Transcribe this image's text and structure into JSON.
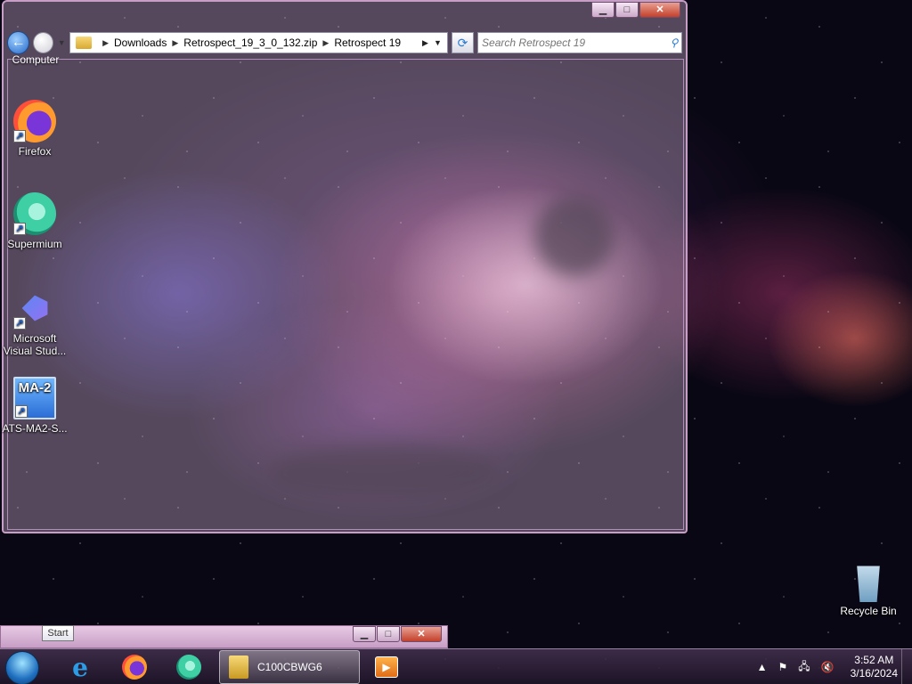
{
  "desktop": {
    "icons": [
      {
        "label": "Computer"
      },
      {
        "label": "Firefox"
      },
      {
        "label": "Supermium"
      },
      {
        "label": "Microsoft Visual Stud..."
      },
      {
        "label": "ATS-MA2-S...",
        "badge_text": "MA-2"
      },
      {
        "label": "Recycle Bin"
      }
    ]
  },
  "explorer": {
    "window_buttons": {
      "minimize": "▁",
      "maximize": "□",
      "close": "✕"
    },
    "breadcrumbs": [
      "Downloads",
      "Retrospect_19_3_0_132.zip",
      "Retrospect 19"
    ],
    "search_placeholder": "Search Retrospect 19",
    "refresh_icon": "⟳",
    "search_icon": "🔍"
  },
  "mini_window": {
    "buttons": {
      "minimize": "▁",
      "maximize": "□",
      "close": "✕"
    }
  },
  "start_tooltip": "Start",
  "taskbar": {
    "active_item_label": "C100CBWG6",
    "ie_glyph": "e",
    "media_glyph": "▶",
    "tray": {
      "expand": "▲",
      "flag_icon": "⚑",
      "network_icon": "🖧",
      "volume_icon": "🔇"
    },
    "clock": {
      "time": "3:52 AM",
      "date": "3/16/2024"
    }
  }
}
